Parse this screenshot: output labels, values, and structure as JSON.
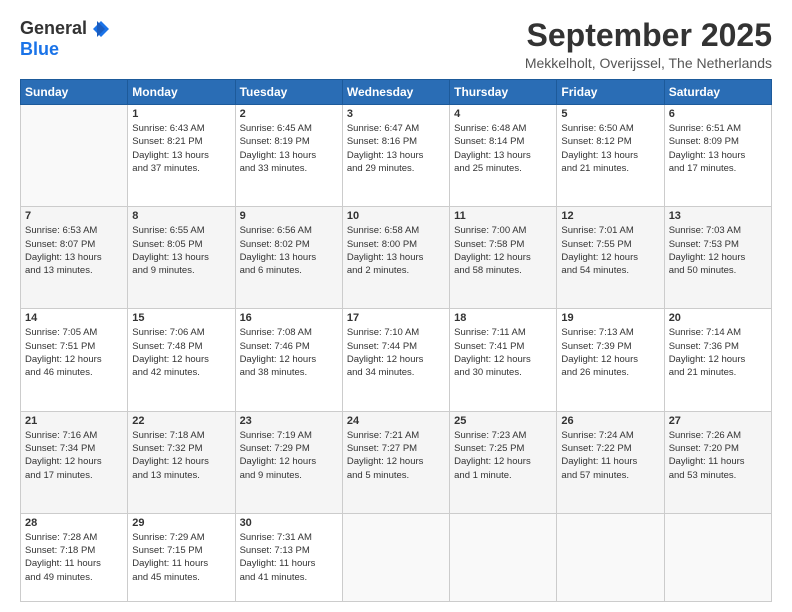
{
  "logo": {
    "general": "General",
    "blue": "Blue"
  },
  "title": "September 2025",
  "location": "Mekkelholt, Overijssel, The Netherlands",
  "weekdays": [
    "Sunday",
    "Monday",
    "Tuesday",
    "Wednesday",
    "Thursday",
    "Friday",
    "Saturday"
  ],
  "weeks": [
    [
      {
        "day": "",
        "info": ""
      },
      {
        "day": "1",
        "info": "Sunrise: 6:43 AM\nSunset: 8:21 PM\nDaylight: 13 hours\nand 37 minutes."
      },
      {
        "day": "2",
        "info": "Sunrise: 6:45 AM\nSunset: 8:19 PM\nDaylight: 13 hours\nand 33 minutes."
      },
      {
        "day": "3",
        "info": "Sunrise: 6:47 AM\nSunset: 8:16 PM\nDaylight: 13 hours\nand 29 minutes."
      },
      {
        "day": "4",
        "info": "Sunrise: 6:48 AM\nSunset: 8:14 PM\nDaylight: 13 hours\nand 25 minutes."
      },
      {
        "day": "5",
        "info": "Sunrise: 6:50 AM\nSunset: 8:12 PM\nDaylight: 13 hours\nand 21 minutes."
      },
      {
        "day": "6",
        "info": "Sunrise: 6:51 AM\nSunset: 8:09 PM\nDaylight: 13 hours\nand 17 minutes."
      }
    ],
    [
      {
        "day": "7",
        "info": "Sunrise: 6:53 AM\nSunset: 8:07 PM\nDaylight: 13 hours\nand 13 minutes."
      },
      {
        "day": "8",
        "info": "Sunrise: 6:55 AM\nSunset: 8:05 PM\nDaylight: 13 hours\nand 9 minutes."
      },
      {
        "day": "9",
        "info": "Sunrise: 6:56 AM\nSunset: 8:02 PM\nDaylight: 13 hours\nand 6 minutes."
      },
      {
        "day": "10",
        "info": "Sunrise: 6:58 AM\nSunset: 8:00 PM\nDaylight: 13 hours\nand 2 minutes."
      },
      {
        "day": "11",
        "info": "Sunrise: 7:00 AM\nSunset: 7:58 PM\nDaylight: 12 hours\nand 58 minutes."
      },
      {
        "day": "12",
        "info": "Sunrise: 7:01 AM\nSunset: 7:55 PM\nDaylight: 12 hours\nand 54 minutes."
      },
      {
        "day": "13",
        "info": "Sunrise: 7:03 AM\nSunset: 7:53 PM\nDaylight: 12 hours\nand 50 minutes."
      }
    ],
    [
      {
        "day": "14",
        "info": "Sunrise: 7:05 AM\nSunset: 7:51 PM\nDaylight: 12 hours\nand 46 minutes."
      },
      {
        "day": "15",
        "info": "Sunrise: 7:06 AM\nSunset: 7:48 PM\nDaylight: 12 hours\nand 42 minutes."
      },
      {
        "day": "16",
        "info": "Sunrise: 7:08 AM\nSunset: 7:46 PM\nDaylight: 12 hours\nand 38 minutes."
      },
      {
        "day": "17",
        "info": "Sunrise: 7:10 AM\nSunset: 7:44 PM\nDaylight: 12 hours\nand 34 minutes."
      },
      {
        "day": "18",
        "info": "Sunrise: 7:11 AM\nSunset: 7:41 PM\nDaylight: 12 hours\nand 30 minutes."
      },
      {
        "day": "19",
        "info": "Sunrise: 7:13 AM\nSunset: 7:39 PM\nDaylight: 12 hours\nand 26 minutes."
      },
      {
        "day": "20",
        "info": "Sunrise: 7:14 AM\nSunset: 7:36 PM\nDaylight: 12 hours\nand 21 minutes."
      }
    ],
    [
      {
        "day": "21",
        "info": "Sunrise: 7:16 AM\nSunset: 7:34 PM\nDaylight: 12 hours\nand 17 minutes."
      },
      {
        "day": "22",
        "info": "Sunrise: 7:18 AM\nSunset: 7:32 PM\nDaylight: 12 hours\nand 13 minutes."
      },
      {
        "day": "23",
        "info": "Sunrise: 7:19 AM\nSunset: 7:29 PM\nDaylight: 12 hours\nand 9 minutes."
      },
      {
        "day": "24",
        "info": "Sunrise: 7:21 AM\nSunset: 7:27 PM\nDaylight: 12 hours\nand 5 minutes."
      },
      {
        "day": "25",
        "info": "Sunrise: 7:23 AM\nSunset: 7:25 PM\nDaylight: 12 hours\nand 1 minute."
      },
      {
        "day": "26",
        "info": "Sunrise: 7:24 AM\nSunset: 7:22 PM\nDaylight: 11 hours\nand 57 minutes."
      },
      {
        "day": "27",
        "info": "Sunrise: 7:26 AM\nSunset: 7:20 PM\nDaylight: 11 hours\nand 53 minutes."
      }
    ],
    [
      {
        "day": "28",
        "info": "Sunrise: 7:28 AM\nSunset: 7:18 PM\nDaylight: 11 hours\nand 49 minutes."
      },
      {
        "day": "29",
        "info": "Sunrise: 7:29 AM\nSunset: 7:15 PM\nDaylight: 11 hours\nand 45 minutes."
      },
      {
        "day": "30",
        "info": "Sunrise: 7:31 AM\nSunset: 7:13 PM\nDaylight: 11 hours\nand 41 minutes."
      },
      {
        "day": "",
        "info": ""
      },
      {
        "day": "",
        "info": ""
      },
      {
        "day": "",
        "info": ""
      },
      {
        "day": "",
        "info": ""
      }
    ]
  ]
}
